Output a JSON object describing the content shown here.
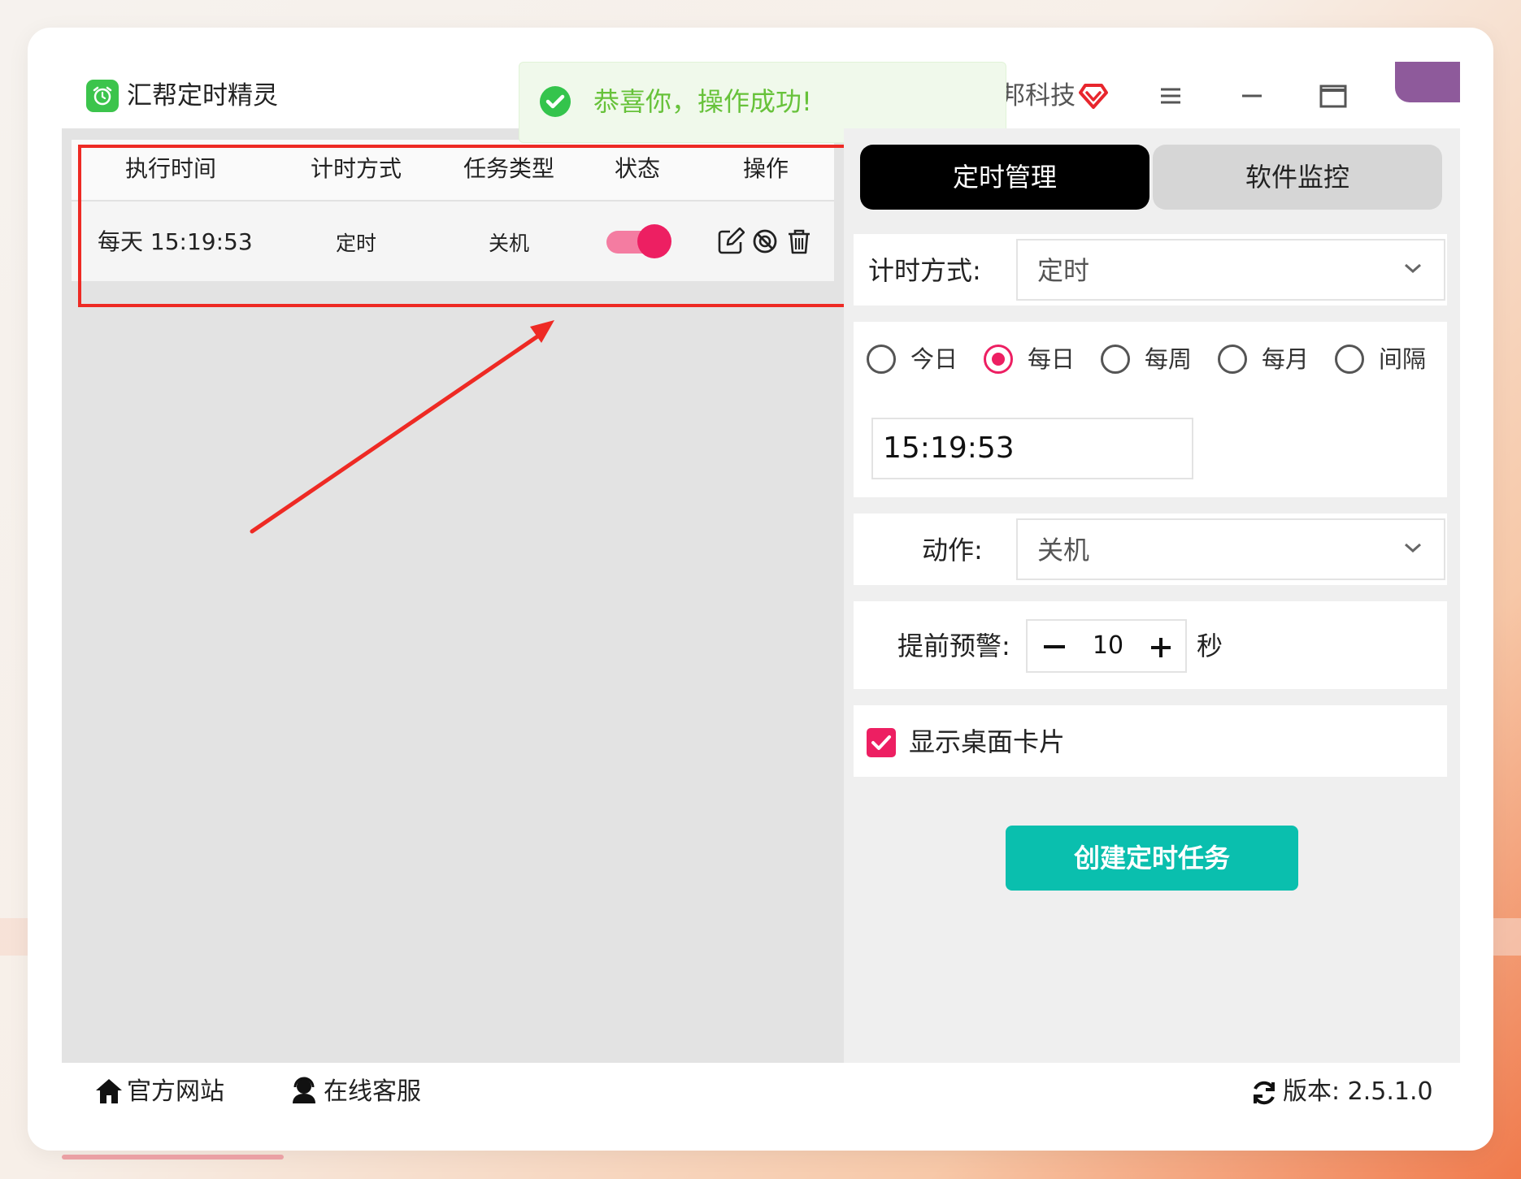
{
  "app": {
    "title": "汇帮定时精灵",
    "brand_partial": "邦科技"
  },
  "toast": {
    "message": "恭喜你，操作成功!"
  },
  "table": {
    "headers": [
      "执行时间",
      "计时方式",
      "任务类型",
      "状态",
      "操作"
    ],
    "rows": [
      {
        "time": "每天 15:19:53",
        "mode": "定时",
        "type": "关机",
        "enabled": true
      }
    ]
  },
  "tabs": [
    "定时管理",
    "软件监控"
  ],
  "form": {
    "timing_label": "计时方式:",
    "timing_value": "定时",
    "frequency_options": [
      "今日",
      "每日",
      "每周",
      "每月",
      "间隔"
    ],
    "frequency_selected": "每日",
    "time_value": "15:19:53",
    "action_label": "动作:",
    "action_value": "关机",
    "warning_label": "提前预警:",
    "warning_value": "10",
    "warning_unit": "秒",
    "show_card_label": "显示桌面卡片",
    "show_card_checked": true,
    "create_button": "创建定时任务"
  },
  "footer": {
    "website": "官方网站",
    "support": "在线客服",
    "version": "版本: 2.5.1.0"
  },
  "scroll_progress": 0.39,
  "colors": {
    "accent": "#ed1f62",
    "primary_button": "#0abfae",
    "success": "#67c23a",
    "highlight_box": "#ee2a24",
    "arrow": "#ee2a24"
  }
}
